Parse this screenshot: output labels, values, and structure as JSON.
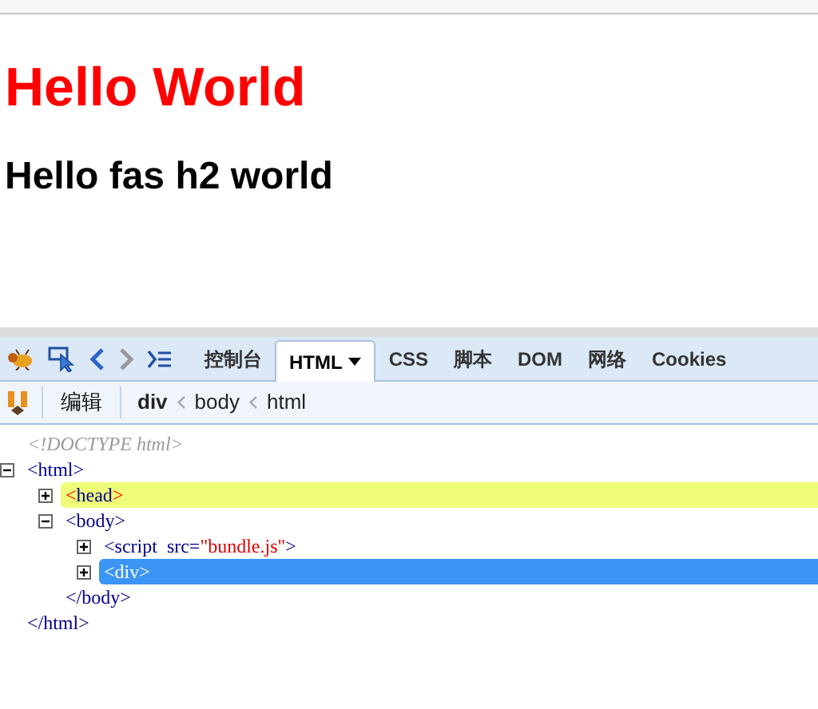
{
  "page": {
    "heading": "Hello World",
    "subheading": "Hello fas h2 world"
  },
  "devtools": {
    "toolbar": {
      "back_enabled": true,
      "forward_enabled": false
    },
    "tabs": [
      {
        "label": "控制台",
        "selected": false
      },
      {
        "label": "HTML",
        "selected": true,
        "menu": true
      },
      {
        "label": "CSS",
        "selected": false
      },
      {
        "label": "脚本",
        "selected": false
      },
      {
        "label": "DOM",
        "selected": false
      },
      {
        "label": "网络",
        "selected": false
      },
      {
        "label": "Cookies",
        "selected": false
      }
    ],
    "edit_button": "编辑",
    "breadcrumbs": [
      {
        "label": "div",
        "selected": true
      },
      {
        "label": "body",
        "selected": false
      },
      {
        "label": "html",
        "selected": false
      }
    ],
    "tree": [
      {
        "kind": "doctype",
        "open": [
          {
            "kind": "doctype",
            "text": "<!DOCTYPE html>"
          }
        ]
      },
      {
        "kind": "element",
        "expanded": true,
        "selected": false,
        "highlighted": false,
        "open": [
          {
            "kind": "tag",
            "text": "<html>"
          }
        ],
        "close": "</html>",
        "children": [
          {
            "kind": "element",
            "expanded": false,
            "selected": false,
            "highlighted": true,
            "open": [
              {
                "kind": "punct",
                "text": "<"
              },
              {
                "kind": "tag",
                "text": "head"
              },
              {
                "kind": "punct",
                "text": ">"
              }
            ]
          },
          {
            "kind": "element",
            "expanded": true,
            "selected": false,
            "highlighted": false,
            "open": [
              {
                "kind": "tag",
                "text": "<body>"
              }
            ],
            "close": "</body>",
            "children": [
              {
                "kind": "element",
                "expanded": false,
                "selected": false,
                "highlighted": false,
                "open": [
                  {
                    "kind": "tag",
                    "text": "<script"
                  },
                  {
                    "kind": "attr",
                    "text": "src="
                  },
                  {
                    "kind": "value",
                    "text": "\"bundle.js\""
                  },
                  {
                    "kind": "tag",
                    "text": ">"
                  }
                ]
              },
              {
                "kind": "element",
                "expanded": false,
                "selected": true,
                "highlighted": false,
                "open": [
                  {
                    "kind": "tag",
                    "text": "<div>"
                  }
                ]
              }
            ]
          }
        ]
      }
    ]
  }
}
